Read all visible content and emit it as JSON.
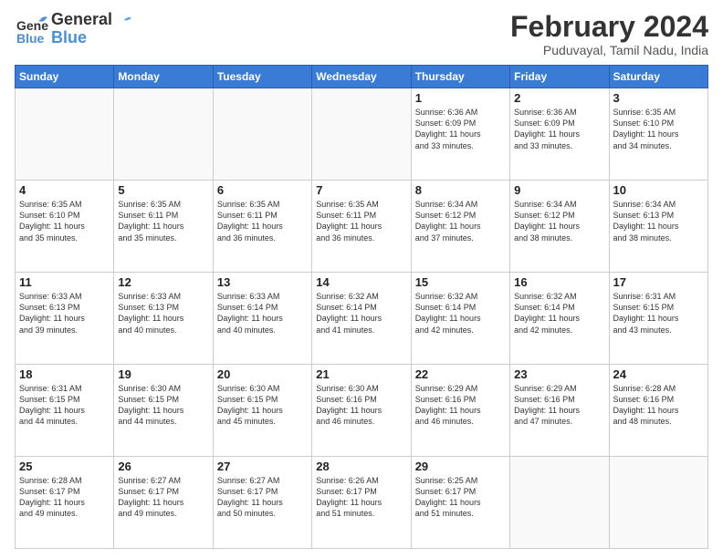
{
  "header": {
    "logo_line1": "General",
    "logo_line2": "Blue",
    "month": "February 2024",
    "location": "Puduvayal, Tamil Nadu, India"
  },
  "weekdays": [
    "Sunday",
    "Monday",
    "Tuesday",
    "Wednesday",
    "Thursday",
    "Friday",
    "Saturday"
  ],
  "weeks": [
    [
      {
        "day": "",
        "info": ""
      },
      {
        "day": "",
        "info": ""
      },
      {
        "day": "",
        "info": ""
      },
      {
        "day": "",
        "info": ""
      },
      {
        "day": "1",
        "info": "Sunrise: 6:36 AM\nSunset: 6:09 PM\nDaylight: 11 hours\nand 33 minutes."
      },
      {
        "day": "2",
        "info": "Sunrise: 6:36 AM\nSunset: 6:09 PM\nDaylight: 11 hours\nand 33 minutes."
      },
      {
        "day": "3",
        "info": "Sunrise: 6:35 AM\nSunset: 6:10 PM\nDaylight: 11 hours\nand 34 minutes."
      }
    ],
    [
      {
        "day": "4",
        "info": "Sunrise: 6:35 AM\nSunset: 6:10 PM\nDaylight: 11 hours\nand 35 minutes."
      },
      {
        "day": "5",
        "info": "Sunrise: 6:35 AM\nSunset: 6:11 PM\nDaylight: 11 hours\nand 35 minutes."
      },
      {
        "day": "6",
        "info": "Sunrise: 6:35 AM\nSunset: 6:11 PM\nDaylight: 11 hours\nand 36 minutes."
      },
      {
        "day": "7",
        "info": "Sunrise: 6:35 AM\nSunset: 6:11 PM\nDaylight: 11 hours\nand 36 minutes."
      },
      {
        "day": "8",
        "info": "Sunrise: 6:34 AM\nSunset: 6:12 PM\nDaylight: 11 hours\nand 37 minutes."
      },
      {
        "day": "9",
        "info": "Sunrise: 6:34 AM\nSunset: 6:12 PM\nDaylight: 11 hours\nand 38 minutes."
      },
      {
        "day": "10",
        "info": "Sunrise: 6:34 AM\nSunset: 6:13 PM\nDaylight: 11 hours\nand 38 minutes."
      }
    ],
    [
      {
        "day": "11",
        "info": "Sunrise: 6:33 AM\nSunset: 6:13 PM\nDaylight: 11 hours\nand 39 minutes."
      },
      {
        "day": "12",
        "info": "Sunrise: 6:33 AM\nSunset: 6:13 PM\nDaylight: 11 hours\nand 40 minutes."
      },
      {
        "day": "13",
        "info": "Sunrise: 6:33 AM\nSunset: 6:14 PM\nDaylight: 11 hours\nand 40 minutes."
      },
      {
        "day": "14",
        "info": "Sunrise: 6:32 AM\nSunset: 6:14 PM\nDaylight: 11 hours\nand 41 minutes."
      },
      {
        "day": "15",
        "info": "Sunrise: 6:32 AM\nSunset: 6:14 PM\nDaylight: 11 hours\nand 42 minutes."
      },
      {
        "day": "16",
        "info": "Sunrise: 6:32 AM\nSunset: 6:14 PM\nDaylight: 11 hours\nand 42 minutes."
      },
      {
        "day": "17",
        "info": "Sunrise: 6:31 AM\nSunset: 6:15 PM\nDaylight: 11 hours\nand 43 minutes."
      }
    ],
    [
      {
        "day": "18",
        "info": "Sunrise: 6:31 AM\nSunset: 6:15 PM\nDaylight: 11 hours\nand 44 minutes."
      },
      {
        "day": "19",
        "info": "Sunrise: 6:30 AM\nSunset: 6:15 PM\nDaylight: 11 hours\nand 44 minutes."
      },
      {
        "day": "20",
        "info": "Sunrise: 6:30 AM\nSunset: 6:15 PM\nDaylight: 11 hours\nand 45 minutes."
      },
      {
        "day": "21",
        "info": "Sunrise: 6:30 AM\nSunset: 6:16 PM\nDaylight: 11 hours\nand 46 minutes."
      },
      {
        "day": "22",
        "info": "Sunrise: 6:29 AM\nSunset: 6:16 PM\nDaylight: 11 hours\nand 46 minutes."
      },
      {
        "day": "23",
        "info": "Sunrise: 6:29 AM\nSunset: 6:16 PM\nDaylight: 11 hours\nand 47 minutes."
      },
      {
        "day": "24",
        "info": "Sunrise: 6:28 AM\nSunset: 6:16 PM\nDaylight: 11 hours\nand 48 minutes."
      }
    ],
    [
      {
        "day": "25",
        "info": "Sunrise: 6:28 AM\nSunset: 6:17 PM\nDaylight: 11 hours\nand 49 minutes."
      },
      {
        "day": "26",
        "info": "Sunrise: 6:27 AM\nSunset: 6:17 PM\nDaylight: 11 hours\nand 49 minutes."
      },
      {
        "day": "27",
        "info": "Sunrise: 6:27 AM\nSunset: 6:17 PM\nDaylight: 11 hours\nand 50 minutes."
      },
      {
        "day": "28",
        "info": "Sunrise: 6:26 AM\nSunset: 6:17 PM\nDaylight: 11 hours\nand 51 minutes."
      },
      {
        "day": "29",
        "info": "Sunrise: 6:25 AM\nSunset: 6:17 PM\nDaylight: 11 hours\nand 51 minutes."
      },
      {
        "day": "",
        "info": ""
      },
      {
        "day": "",
        "info": ""
      }
    ]
  ]
}
